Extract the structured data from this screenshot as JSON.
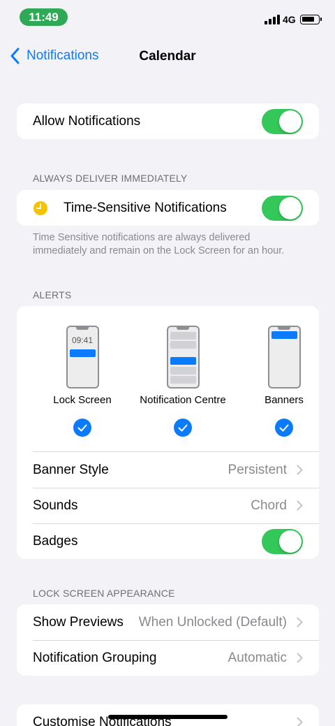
{
  "status_bar": {
    "time": "11:49",
    "network": "4G"
  },
  "nav": {
    "back_label": "Notifications",
    "title": "Calendar"
  },
  "allow": {
    "label": "Allow Notifications",
    "on": true
  },
  "always_deliver": {
    "header": "ALWAYS DELIVER IMMEDIATELY",
    "label": "Time-Sensitive Notifications",
    "on": true,
    "footnote": "Time Sensitive notifications are always delivered immediately and remain on the Lock Screen for an hour."
  },
  "alerts": {
    "header": "ALERTS",
    "lock_screen_time": "09:41",
    "options": [
      {
        "label": "Lock Screen",
        "checked": true
      },
      {
        "label": "Notification Centre",
        "checked": true
      },
      {
        "label": "Banners",
        "checked": true
      }
    ],
    "banner_style": {
      "label": "Banner Style",
      "value": "Persistent"
    },
    "sounds": {
      "label": "Sounds",
      "value": "Chord"
    },
    "badges": {
      "label": "Badges",
      "on": true
    }
  },
  "lock_screen_appearance": {
    "header": "LOCK SCREEN APPEARANCE",
    "show_previews": {
      "label": "Show Previews",
      "value": "When Unlocked (Default)"
    },
    "grouping": {
      "label": "Notification Grouping",
      "value": "Automatic"
    }
  },
  "customise": {
    "label": "Customise Notifications"
  },
  "colors": {
    "accent": "#0a7aff",
    "toggle_on": "#34c759",
    "time_pill": "#30a957",
    "clock_icon": "#f5c400"
  },
  "icons": [
    "back-chevron-icon",
    "clock-icon",
    "checkmark-icon",
    "chevron-right-icon",
    "signal-icon",
    "battery-icon"
  ]
}
